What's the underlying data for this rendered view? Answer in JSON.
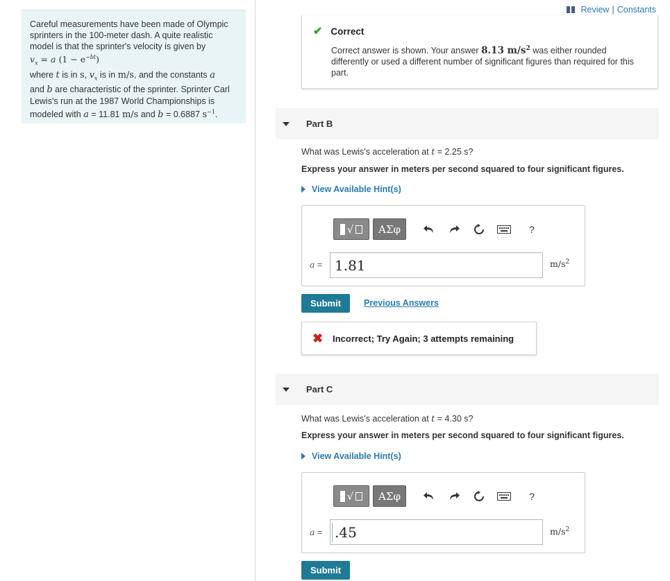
{
  "header": {
    "review_label": "Review",
    "separator": "|",
    "constants_label": "Constants"
  },
  "problem": {
    "line1": "Careful measurements have been made of Olympic",
    "line2": "sprinters in the 100-meter dash. A quite realistic",
    "line3": "model is that the sprinter's velocity is given by",
    "formula_prefix": "v",
    "formula_sub": "x",
    "formula_eq": " = a ",
    "formula_paren": "(1 − e",
    "formula_exp": "−bt",
    "formula_close": ")",
    "line5a": "where ",
    "var_t": "t",
    "line5b": " is in ",
    "unit_s": "s",
    "line5c": ", ",
    "var_vx": "v",
    "var_vx_sub": "x",
    "line5d": " is in ",
    "unit_ms": "m/s",
    "line5e": ", and the constants ",
    "var_a": "a",
    "line6a": "and ",
    "var_b": "b",
    "line6b": " are characteristic of the sprinter. Sprinter Carl",
    "line7": "Lewis's run at the 1987 World Championships is",
    "line8a": "modeled with ",
    "var_a2": "a",
    "line8b": " = 11.81 ",
    "unit_ms2": "m/s",
    "line8c": " and ",
    "var_b2": "b",
    "line8d": " = 0.6887 ",
    "unit_sinv": "s",
    "unit_sinv_exp": "−1",
    "line8e": "."
  },
  "part_a_result": {
    "status": "Correct",
    "msg_a": "Correct answer is shown. Your answer ",
    "your_answer": "8.13 m/s",
    "your_answer_exp": "2",
    "msg_b": " was either rounded",
    "msg_line2": "differently or used a different number of significant figures than required for this",
    "msg_line3": "part."
  },
  "part_b": {
    "label": "Part B",
    "question_a": "What was Lewis's acceleration at ",
    "question_var": "t",
    "question_b": " = 2.25 s?",
    "instruction": "Express your answer in meters per second squared to four significant figures.",
    "hint_label": "View Available Hint(s)",
    "greek_label": "ΑΣφ",
    "var_label": "a",
    "var_eq": " =",
    "input_value": "1.81",
    "unit": "m/s",
    "unit_exp": "2",
    "submit_label": "Submit",
    "previous_label": "Previous Answers",
    "feedback": "Incorrect; Try Again; 3 attempts remaining",
    "help_label": "?"
  },
  "part_c": {
    "label": "Part C",
    "question_a": "What was Lewis's acceleration at ",
    "question_var": "t",
    "question_b": " = 4.30 s?",
    "instruction": "Express your answer in meters per second squared to four significant figures.",
    "hint_label": "View Available Hint(s)",
    "greek_label": "ΑΣφ",
    "var_label": "a",
    "var_eq": " =",
    "input_value": ".45",
    "unit": "m/s",
    "unit_exp": "2",
    "submit_label": "Submit",
    "help_label": "?"
  },
  "colors": {
    "accent": "#1f7a96",
    "link": "#2a7ab0",
    "correct": "#3a9a37",
    "incorrect": "#cc1f1f",
    "problem_bg": "#e8f4f5"
  }
}
